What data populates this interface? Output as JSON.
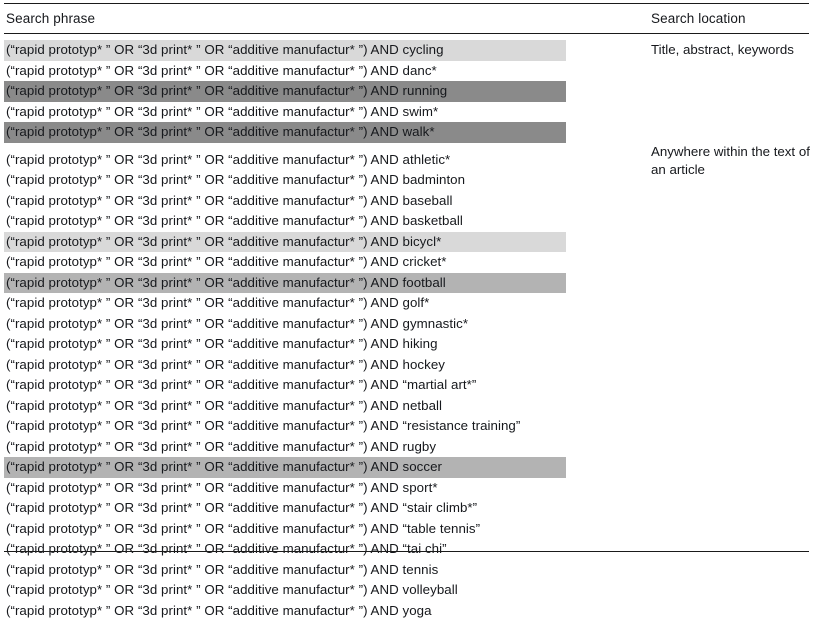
{
  "table": {
    "columns": {
      "phrase_header": "Search phrase",
      "location_header": "Search location"
    },
    "base_phrase": "(“rapid prototyp* ” OR “3d print* ” OR “additive manufactur* ”) AND ",
    "locations": [
      "Title, abstract, keywords",
      "Anywhere within the text of an article"
    ],
    "highlight_colors": {
      "none": "transparent",
      "light": "#d9d9d9",
      "medium": "#b3b3b3",
      "dark": "#8a8a8a"
    },
    "rows": [
      {
        "term": "cycling",
        "phrase": "(“rapid prototyp* ” OR “3d print* ” OR “additive manufactur* ”) AND cycling",
        "highlight": "light",
        "location_group": 1
      },
      {
        "term": "danc*",
        "phrase": "(“rapid prototyp* ” OR “3d print* ” OR “additive manufactur* ”) AND danc*",
        "highlight": "none",
        "location_group": 1
      },
      {
        "term": "running",
        "phrase": "(“rapid prototyp* ” OR “3d print* ” OR “additive manufactur* ”) AND running",
        "highlight": "dark",
        "location_group": 1
      },
      {
        "term": "swim*",
        "phrase": "(“rapid prototyp* ” OR “3d print* ” OR “additive manufactur* ”) AND swim*",
        "highlight": "none",
        "location_group": 1
      },
      {
        "term": "walk*",
        "phrase": "(“rapid prototyp* ” OR “3d print* ” OR “additive manufactur* ”) AND walk*",
        "highlight": "dark",
        "location_group": 1
      },
      {
        "term": "athletic*",
        "phrase": "(“rapid prototyp* ” OR “3d print* ” OR “additive manufactur* ”) AND athletic*",
        "highlight": "none",
        "location_group": 2
      },
      {
        "term": "badminton",
        "phrase": "(“rapid prototyp* ” OR “3d print* ” OR “additive manufactur* ”) AND badminton",
        "highlight": "none",
        "location_group": 2
      },
      {
        "term": "baseball",
        "phrase": "(“rapid prototyp* ” OR “3d print* ” OR “additive manufactur* ”) AND baseball",
        "highlight": "none",
        "location_group": 2
      },
      {
        "term": "basketball",
        "phrase": "(“rapid prototyp* ” OR “3d print* ” OR “additive manufactur* ”) AND basketball",
        "highlight": "none",
        "location_group": 2
      },
      {
        "term": "bicycl*",
        "phrase": "(“rapid prototyp* ” OR “3d print* ” OR “additive manufactur* ”) AND bicycl*",
        "highlight": "light",
        "location_group": 2
      },
      {
        "term": "cricket*",
        "phrase": "(“rapid prototyp* ” OR “3d print* ” OR “additive manufactur* ”) AND cricket*",
        "highlight": "none",
        "location_group": 2
      },
      {
        "term": "football",
        "phrase": "(“rapid prototyp* ” OR “3d print* ” OR “additive manufactur* ”) AND football",
        "highlight": "medium",
        "location_group": 2
      },
      {
        "term": "golf*",
        "phrase": "(“rapid prototyp* ” OR “3d print* ” OR “additive manufactur* ”) AND golf*",
        "highlight": "none",
        "location_group": 2
      },
      {
        "term": "gymnastic*",
        "phrase": "(“rapid prototyp* ” OR “3d print* ” OR “additive manufactur* ”) AND gymnastic*",
        "highlight": "none",
        "location_group": 2
      },
      {
        "term": "hiking",
        "phrase": "(“rapid prototyp* ” OR “3d print* ” OR “additive manufactur* ”) AND hiking",
        "highlight": "none",
        "location_group": 2
      },
      {
        "term": "hockey",
        "phrase": "(“rapid prototyp* ” OR “3d print* ” OR “additive manufactur* ”) AND hockey",
        "highlight": "none",
        "location_group": 2
      },
      {
        "term": "“martial art*”",
        "phrase": "(“rapid prototyp* ” OR “3d print* ” OR “additive manufactur* ”) AND “martial art*”",
        "highlight": "none",
        "location_group": 2
      },
      {
        "term": "netball",
        "phrase": "(“rapid prototyp* ” OR “3d print* ” OR “additive manufactur* ”) AND netball",
        "highlight": "none",
        "location_group": 2
      },
      {
        "term": "“resistance training”",
        "phrase": "(“rapid prototyp* ” OR “3d print* ” OR “additive manufactur* ”) AND “resistance training”",
        "highlight": "none",
        "location_group": 2
      },
      {
        "term": "rugby",
        "phrase": "(“rapid prototyp* ” OR “3d print* ” OR “additive manufactur* ”) AND rugby",
        "highlight": "none",
        "location_group": 2
      },
      {
        "term": "soccer",
        "phrase": "(“rapid prototyp* ” OR “3d print* ” OR “additive manufactur* ”) AND soccer",
        "highlight": "medium",
        "location_group": 2
      },
      {
        "term": "sport*",
        "phrase": "(“rapid prototyp* ” OR “3d print* ” OR “additive manufactur* ”) AND sport*",
        "highlight": "none",
        "location_group": 2
      },
      {
        "term": "“stair climb*”",
        "phrase": "(“rapid prototyp* ” OR “3d print* ” OR “additive manufactur* ”) AND “stair climb*”",
        "highlight": "none",
        "location_group": 2
      },
      {
        "term": "“table tennis”",
        "phrase": "(“rapid prototyp* ” OR “3d print* ” OR “additive manufactur* ”) AND “table tennis”",
        "highlight": "none",
        "location_group": 2
      },
      {
        "term": "“tai chi”",
        "phrase": "(“rapid prototyp* ” OR “3d print* ” OR “additive manufactur* ”) AND “tai chi”",
        "highlight": "none",
        "location_group": 2
      },
      {
        "term": "tennis",
        "phrase": "(“rapid prototyp* ” OR “3d print* ” OR “additive manufactur* ”) AND tennis",
        "highlight": "none",
        "location_group": 2
      },
      {
        "term": "volleyball",
        "phrase": "(“rapid prototyp* ” OR “3d print* ” OR “additive manufactur* ”) AND volleyball",
        "highlight": "none",
        "location_group": 2
      },
      {
        "term": "yoga",
        "phrase": "(“rapid prototyp* ” OR “3d print* ” OR “additive manufactur* ”) AND yoga",
        "highlight": "none",
        "location_group": 2
      }
    ]
  }
}
